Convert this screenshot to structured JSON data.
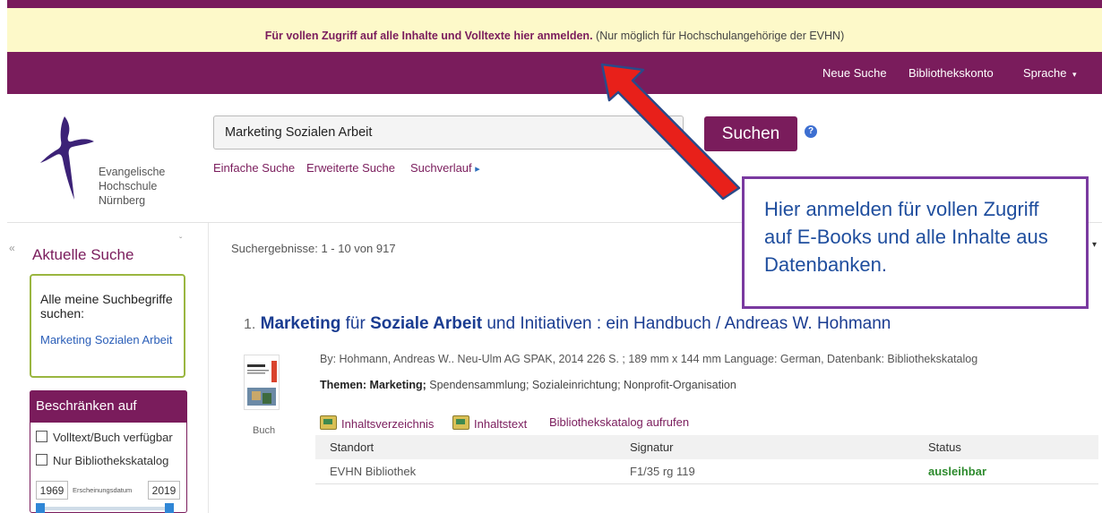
{
  "notice": {
    "bold": "Für vollen Zugriff auf alle Inhalte und Volltexte hier anmelden.",
    "rest": "(Nur möglich für Hochschulangehörige der EVHN)"
  },
  "nav": {
    "new_search": "Neue Suche",
    "account": "Bibliothekskonto",
    "language": "Sprache",
    "language_caret": "▾"
  },
  "logo": {
    "line1": "Evangelische",
    "line2": "Hochschule",
    "line3": "Nürnberg"
  },
  "search": {
    "value": "Marketing Sozialen Arbeit",
    "button": "Suchen",
    "help": "?",
    "simple": "Einfache Suche",
    "advanced": "Erweiterte Suche",
    "history": "Suchverlauf",
    "history_arrow": "▸"
  },
  "sidebar": {
    "collapse": "«",
    "title": "Aktuelle Suche",
    "chevron": "ˇ",
    "terms_heading": "Alle meine Suchbegriffe suchen:",
    "terms_link": "Marketing Sozialen Arbeit",
    "restrict_title": "Beschränken auf",
    "option1": "Volltext/Buch verfügbar",
    "option2": "Nur Bibliothekskatalog",
    "year_from": "1969",
    "year_label": "Erscheinungsdatum",
    "year_to": "2019"
  },
  "results": {
    "count": "Suchergebnisse: 1 - 10 von 917",
    "sort_caret": "▾"
  },
  "callout": {
    "text": "Hier anmelden für vollen Zugriff auf E-Books und alle Inhalte aus Datenbanken."
  },
  "result1": {
    "num": "1.",
    "title_parts": [
      "Marketing",
      " für ",
      "Soziale Arbeit",
      " und Initiativen : ein Handbuch / Andreas W. Hohmann"
    ],
    "type": "Buch",
    "meta": "By: Hohmann, Andreas W.. Neu-Ulm AG SPAK, 2014 226 S. ; 189 mm x 144 mm Language: German, Datenbank: Bibliothekskatalog",
    "themes_label": "Themen: Marketing;",
    "themes_rest": " Spendensammlung; Sozialeinrichtung; Nonprofit-Organisation",
    "link_toc": "Inhaltsverzeichnis",
    "link_text": "Inhaltstext",
    "link_catalog": "Bibliothekskatalog aufrufen",
    "table": {
      "headers": [
        "Standort",
        "Signatur",
        "Status"
      ],
      "row": [
        "EVHN Bibliothek",
        "F1/35 rg 119",
        "ausleihbar"
      ]
    }
  },
  "colors": {
    "brand_purple": "#7a1c5c",
    "notice_bg": "#fdf9c9",
    "arrow_red": "#e8201a",
    "callout_border": "#7a3aa0",
    "status_green": "#2e8b2e"
  }
}
